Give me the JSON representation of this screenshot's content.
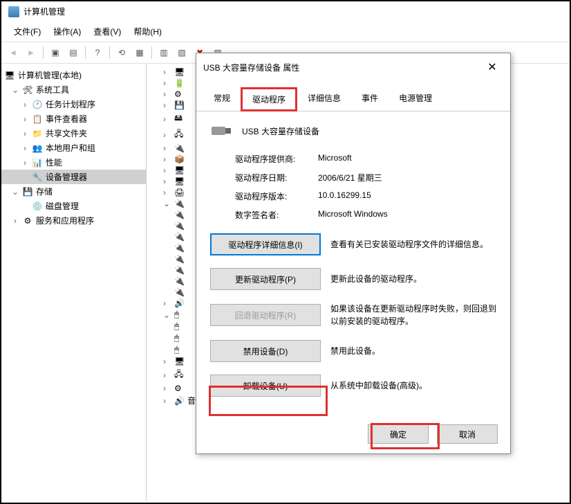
{
  "window": {
    "title": "计算机管理"
  },
  "menu": {
    "file": "文件(F)",
    "action": "操作(A)",
    "view": "查看(V)",
    "help": "帮助(H)"
  },
  "tree": {
    "root": "计算机管理(本地)",
    "systools": "系统工具",
    "task": "任务计划程序",
    "event": "事件查看器",
    "shared": "共享文件夹",
    "users": "本地用户和组",
    "perf": "性能",
    "devmgr": "设备管理器",
    "storage": "存储",
    "disk": "磁盘管理",
    "services": "服务和应用程序"
  },
  "devlist_last": "音频输入和输出",
  "dialog": {
    "title": "USB 大容量存储设备 属性",
    "tabs": {
      "general": "常规",
      "driver": "驱动程序",
      "details": "详细信息",
      "events": "事件",
      "power": "电源管理"
    },
    "device_name": "USB 大容量存储设备",
    "rows": {
      "provider_l": "驱动程序提供商:",
      "provider_v": "Microsoft",
      "date_l": "驱动程序日期:",
      "date_v": "2006/6/21 星期三",
      "version_l": "驱动程序版本:",
      "version_v": "10.0.16299.15",
      "signer_l": "数字签名者:",
      "signer_v": "Microsoft Windows"
    },
    "buttons": {
      "details": "驱动程序详细信息(I)",
      "details_d": "查看有关已安装驱动程序文件的详细信息。",
      "update": "更新驱动程序(P)",
      "update_d": "更新此设备的驱动程序。",
      "rollback": "回退驱动程序(R)",
      "rollback_d": "如果该设备在更新驱动程序时失败，则回退到以前安装的驱动程序。",
      "disable": "禁用设备(D)",
      "disable_d": "禁用此设备。",
      "uninstall": "卸载设备(U)",
      "uninstall_d": "从系统中卸载设备(高级)。"
    },
    "ok": "确定",
    "cancel": "取消"
  }
}
